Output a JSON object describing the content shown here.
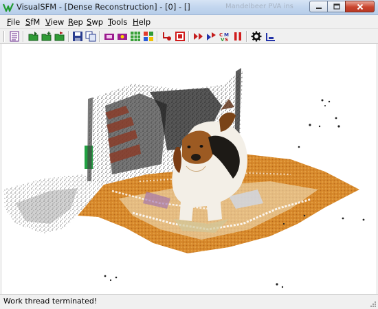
{
  "window": {
    "title": "VisualSFM - [Dense Reconstruction] - [0] - []",
    "ghost_title": "Mandelbeer PVA ins"
  },
  "menu": [
    {
      "label": "File"
    },
    {
      "label": "SfM"
    },
    {
      "label": "View"
    },
    {
      "label": "Rep"
    },
    {
      "label": "Swp"
    },
    {
      "label": "Tools"
    },
    {
      "label": "Help"
    }
  ],
  "toolbar": {
    "icons": [
      "log-window-icon",
      "open-folder-icon",
      "open-folder-add-icon",
      "open-folder-match-icon",
      "save-icon",
      "copy-icon",
      "view-cameras-icon",
      "view-features-icon",
      "view-match-matrix-icon",
      "view-thumbnails-icon",
      "compute-matches-icon",
      "cancel-task-icon",
      "sparse-reconstruction-icon",
      "dense-reconstruction-icon",
      "bundle-adjustment-icon",
      "pause-icon",
      "settings-gear-icon",
      "show-points-icon"
    ]
  },
  "status": {
    "text": "Work thread terminated!"
  },
  "viewport": {
    "description_colors": {
      "floor_orange": "#d98a2a",
      "background": "#ffffff",
      "dog_brown": "#8a4c1e"
    }
  }
}
